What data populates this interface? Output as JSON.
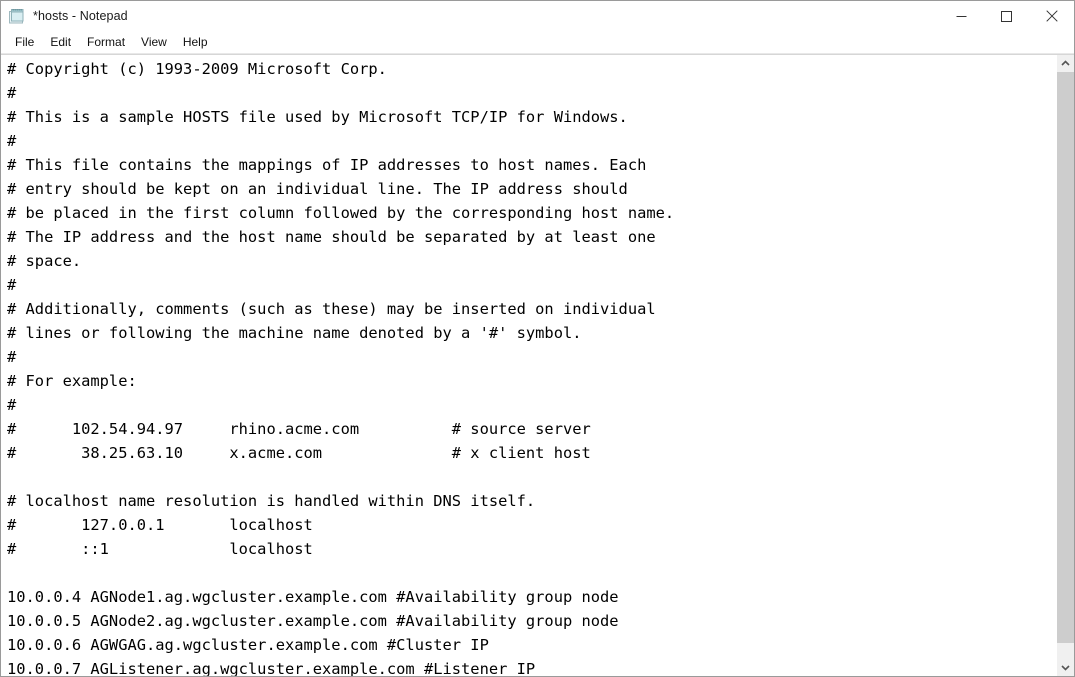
{
  "window": {
    "title": "*hosts - Notepad",
    "icon": "notepad-icon",
    "controls": {
      "minimize": "minimize-icon",
      "maximize": "maximize-icon",
      "close": "close-icon"
    }
  },
  "menubar": {
    "items": [
      {
        "label": "File"
      },
      {
        "label": "Edit"
      },
      {
        "label": "Format"
      },
      {
        "label": "View"
      },
      {
        "label": "Help"
      }
    ]
  },
  "editor": {
    "lines": [
      "# Copyright (c) 1993-2009 Microsoft Corp.",
      "#",
      "# This is a sample HOSTS file used by Microsoft TCP/IP for Windows.",
      "#",
      "# This file contains the mappings of IP addresses to host names. Each",
      "# entry should be kept on an individual line. The IP address should",
      "# be placed in the first column followed by the corresponding host name.",
      "# The IP address and the host name should be separated by at least one",
      "# space.",
      "#",
      "# Additionally, comments (such as these) may be inserted on individual",
      "# lines or following the machine name denoted by a '#' symbol.",
      "#",
      "# For example:",
      "#",
      "#      102.54.94.97     rhino.acme.com          # source server",
      "#       38.25.63.10     x.acme.com              # x client host",
      "",
      "# localhost name resolution is handled within DNS itself.",
      "#       127.0.0.1       localhost",
      "#       ::1             localhost",
      "",
      "10.0.0.4 AGNode1.ag.wgcluster.example.com #Availability group node",
      "10.0.0.5 AGNode2.ag.wgcluster.example.com #Availability group node",
      "10.0.0.6 AGWGAG.ag.wgcluster.example.com #Cluster IP",
      "10.0.0.7 AGListener.ag.wgcluster.example.com #Listener IP"
    ]
  },
  "scrollbar": {
    "up_arrow": "chevron-up-icon",
    "down_arrow": "chevron-down-icon",
    "thumb": "scrollbar-thumb"
  },
  "colors": {
    "window_bg": "#ffffff",
    "text": "#000000",
    "scrollbar_track": "#f0f0f0",
    "scrollbar_thumb": "#cdcdcd",
    "border": "#9a9a9a"
  }
}
